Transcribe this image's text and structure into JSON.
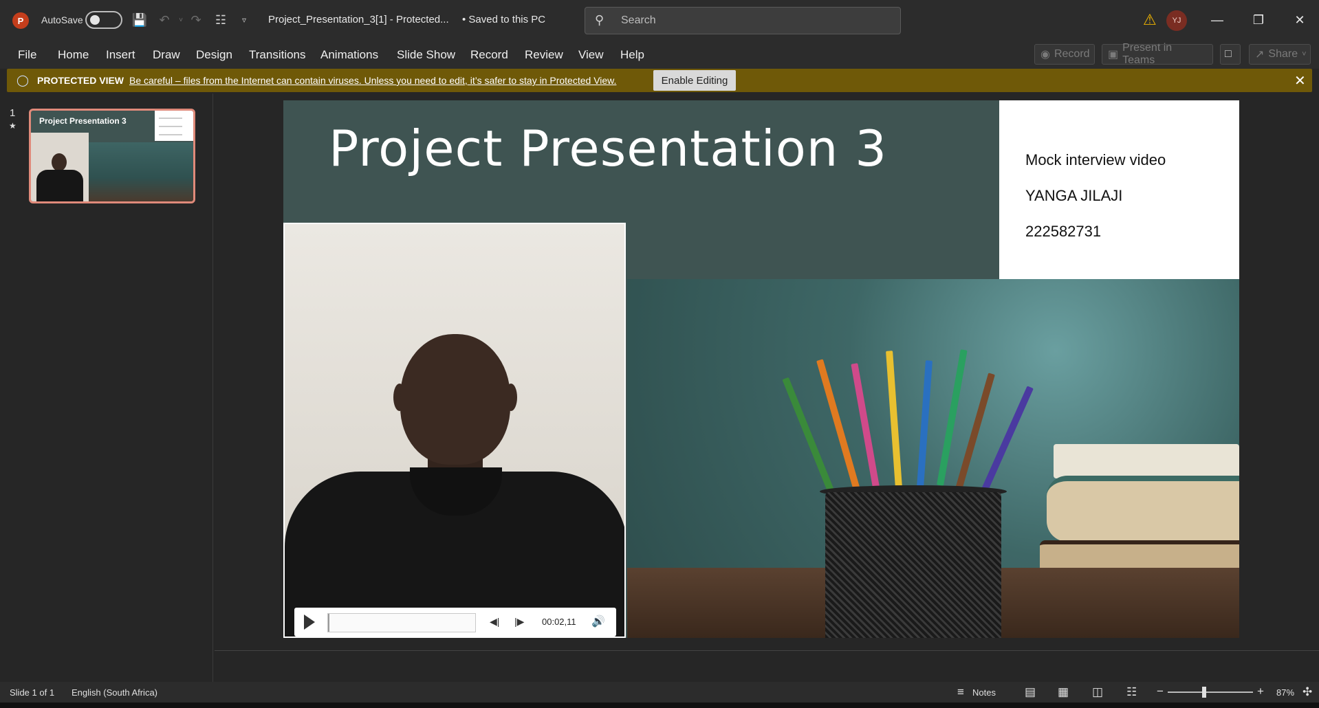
{
  "titlebar": {
    "app_letter": "P",
    "autosave_label": "AutoSave",
    "autosave_on": false,
    "doc_title": "Project_Presentation_3[1]  -  Protected...",
    "saved_status": "•  Saved to this PC",
    "search_placeholder": "Search",
    "user_initials": "YJ"
  },
  "ribbon": {
    "tabs": [
      "File",
      "Home",
      "Insert",
      "Draw",
      "Design",
      "Transitions",
      "Animations",
      "Slide Show",
      "Record",
      "Review",
      "View",
      "Help"
    ],
    "record_label": "Record",
    "present_label": "Present in Teams",
    "share_label": "Share"
  },
  "protected_view": {
    "label": "PROTECTED VIEW",
    "message": "Be careful – files from the Internet can contain viruses. Unless you need to edit, it’s safer to stay in Protected View.",
    "enable_button": "Enable Editing"
  },
  "thumbnails": [
    {
      "number": "1",
      "star": "★",
      "title": "Project Presentation 3"
    }
  ],
  "slide": {
    "title": "Project Presentation 3",
    "info_lines": [
      "Mock interview video",
      "YANGA JILAJI",
      "222582731"
    ],
    "video": {
      "time": "00:02,11",
      "progress_fraction": 0.01
    }
  },
  "status": {
    "slide_info": "Slide 1 of 1",
    "language": "English (South Africa)",
    "notes_label": "Notes",
    "zoom": "87%"
  },
  "colors": {
    "slide_bg": "#3f5452",
    "protected_bar": "#6f5908",
    "thumb_border": "#e08a7a",
    "accent_logo": "#c43e1c"
  }
}
